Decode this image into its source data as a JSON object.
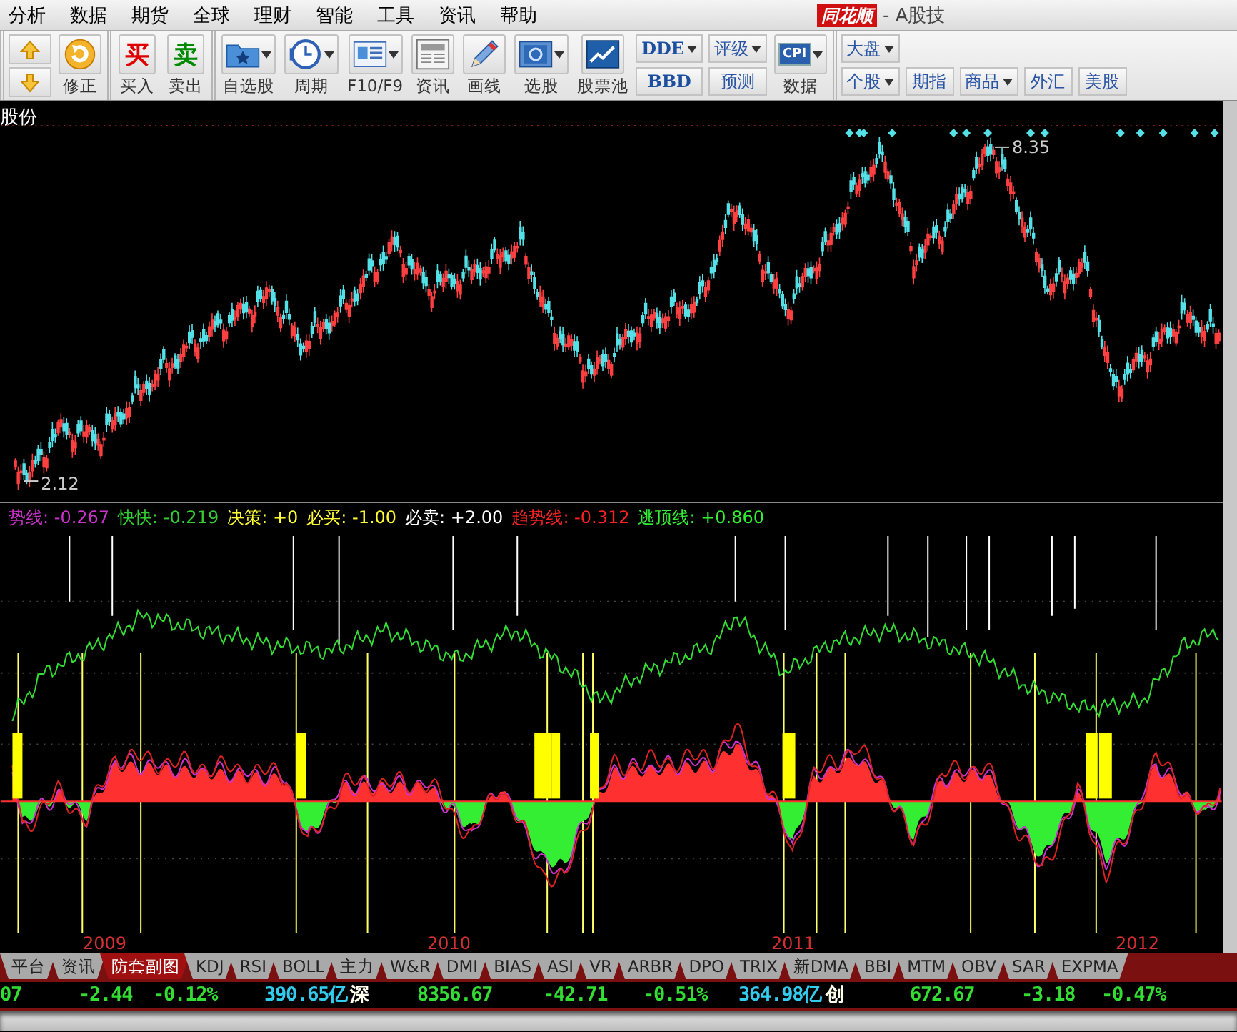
{
  "title_bar": {
    "logo": "同花顺",
    "title": "- A股技"
  },
  "menu": [
    "分析",
    "数据",
    "期货",
    "全球",
    "理财",
    "智能",
    "工具",
    "资讯",
    "帮助"
  ],
  "toolbar": {
    "groups": [
      [
        {
          "kind": "updown"
        },
        {
          "kind": "refresh",
          "label": "修正",
          "dropdown": false
        }
      ],
      [
        {
          "kind": "glyph",
          "glyph": "买",
          "color": "#e00000",
          "label": "买入",
          "dropdown": false
        },
        {
          "kind": "glyph",
          "glyph": "卖",
          "color": "#008a00",
          "label": "卖出",
          "dropdown": false
        }
      ],
      [
        {
          "kind": "folder",
          "label": "自选股",
          "dropdown": true
        },
        {
          "kind": "clock",
          "label": "周期",
          "dropdown": true
        },
        {
          "kind": "doc",
          "label": "F10/F9",
          "dropdown": true
        },
        {
          "kind": "news",
          "label": "资讯",
          "dropdown": false
        },
        {
          "kind": "pencil",
          "label": "画线",
          "dropdown": false
        },
        {
          "kind": "monitor",
          "label": "选股",
          "dropdown": true
        },
        {
          "kind": "trend",
          "label": "股票池",
          "dropdown": false
        },
        {
          "kind": "codepair",
          "top": {
            "label": "DDE",
            "dropdown": true
          },
          "bottom": {
            "label": "BBD",
            "dropdown": false
          }
        },
        {
          "kind": "pair",
          "top": {
            "label": "评级",
            "dropdown": true
          },
          "bottom": {
            "label": "预测",
            "dropdown": false
          }
        },
        {
          "kind": "cpi",
          "glyph": "CPI",
          "label": "数据",
          "dropdown": true
        }
      ],
      [
        {
          "kind": "pair",
          "top": {
            "label": "大盘",
            "dropdown": true
          },
          "bottom": {
            "label": "个股",
            "dropdown": true
          }
        },
        {
          "kind": "pair",
          "bottom": {
            "label": "期指",
            "dropdown": false
          }
        },
        {
          "kind": "pair",
          "bottom": {
            "label": "商品",
            "dropdown": true
          }
        },
        {
          "kind": "pair",
          "bottom": {
            "label": "外汇",
            "dropdown": false
          }
        },
        {
          "kind": "pair",
          "bottom": {
            "label": "美股",
            "dropdown": false
          }
        }
      ]
    ]
  },
  "chart": {
    "stock_name": "股份",
    "low_label": "2.12",
    "high_label": "8.35",
    "legend": [
      {
        "label": "势线:",
        "value": "-0.267",
        "color": "#cc33cc"
      },
      {
        "label": "快快:",
        "value": "-0.219",
        "color": "#33cc33"
      },
      {
        "label": "决策:",
        "value": "+0",
        "color": "#ffff33"
      },
      {
        "label": "必买:",
        "value": "-1.00",
        "color": "#ffff33"
      },
      {
        "label": "必卖:",
        "value": "+2.00",
        "color": "#ffffff"
      },
      {
        "label": "趋势线:",
        "value": "-0.312",
        "color": "#ff2222"
      },
      {
        "label": "逃顶线:",
        "value": "+0.860",
        "color": "#33ee33"
      }
    ],
    "years": [
      "2009",
      "2010",
      "2011",
      "2012"
    ]
  },
  "tabs": [
    {
      "label": "平台",
      "selected": false
    },
    {
      "label": "资讯",
      "selected": false
    },
    {
      "label": "防套副图",
      "selected": true
    },
    {
      "label": "KDJ",
      "selected": false
    },
    {
      "label": "RSI",
      "selected": false
    },
    {
      "label": "BOLL",
      "selected": false
    },
    {
      "label": "主力",
      "selected": false
    },
    {
      "label": "W&R",
      "selected": false
    },
    {
      "label": "DMI",
      "selected": false
    },
    {
      "label": "BIAS",
      "selected": false
    },
    {
      "label": "ASI",
      "selected": false
    },
    {
      "label": "VR",
      "selected": false
    },
    {
      "label": "ARBR",
      "selected": false
    },
    {
      "label": "DPO",
      "selected": false
    },
    {
      "label": "TRIX",
      "selected": false
    },
    {
      "label": "新DMA",
      "selected": false
    },
    {
      "label": "BBI",
      "selected": false
    },
    {
      "label": "MTM",
      "selected": false
    },
    {
      "label": "OBV",
      "selected": false
    },
    {
      "label": "SAR",
      "selected": false
    },
    {
      "label": "EXPMA",
      "selected": false
    }
  ],
  "status_bar": [
    {
      "text": "07",
      "kind": "quote"
    },
    {
      "text": "-2.44",
      "kind": "quote"
    },
    {
      "text": "-0.12%",
      "kind": "quote"
    },
    {
      "text": "390.65亿",
      "kind": "amount"
    },
    {
      "text": "深",
      "kind": "market"
    },
    {
      "text": "8356.67",
      "kind": "quote"
    },
    {
      "text": "-42.71",
      "kind": "quote"
    },
    {
      "text": "-0.51%",
      "kind": "quote"
    },
    {
      "text": "364.98亿",
      "kind": "amount"
    },
    {
      "text": "创",
      "kind": "market"
    },
    {
      "text": "672.67",
      "kind": "quote"
    },
    {
      "text": "-3.18",
      "kind": "quote"
    },
    {
      "text": "-0.47%",
      "kind": "quote"
    }
  ]
}
